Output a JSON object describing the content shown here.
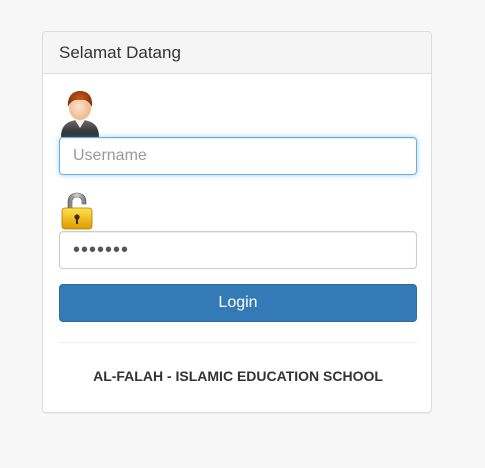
{
  "panel": {
    "title": "Selamat Datang"
  },
  "form": {
    "username_placeholder": "Username",
    "username_value": "",
    "password_value": "•••••••",
    "login_label": "Login"
  },
  "footer": {
    "school_name": "AL-FALAH - ISLAMIC EDUCATION SCHOOL"
  },
  "icons": {
    "user": "user-avatar-icon",
    "lock": "padlock-icon"
  },
  "colors": {
    "primary": "#337ab7",
    "focus": "#66afe9"
  }
}
